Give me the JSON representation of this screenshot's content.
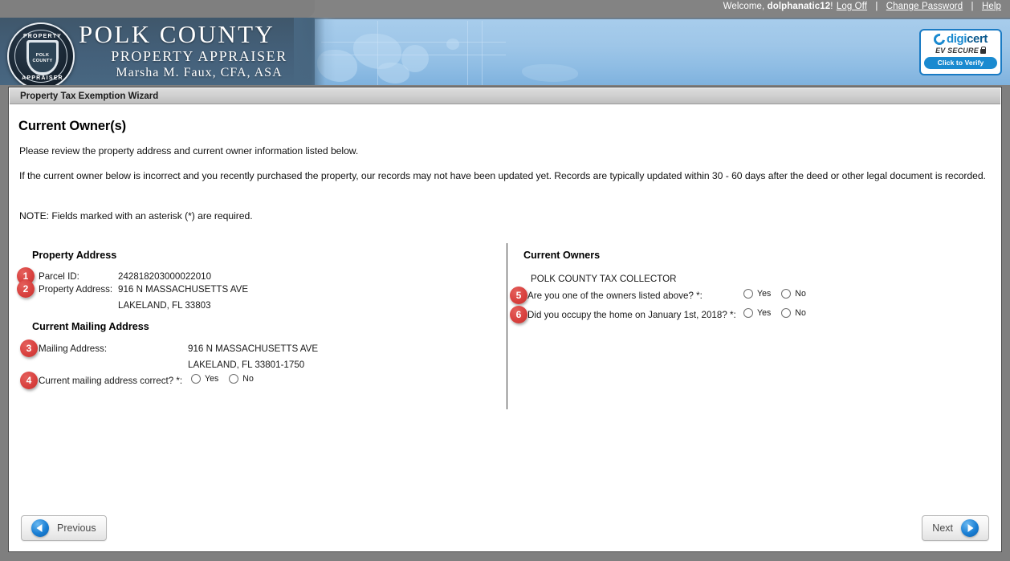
{
  "topbar": {
    "welcome_prefix": "Welcome,",
    "user_name": "dolphanatic12",
    "welcome_suffix": "!",
    "log_off": "Log Off",
    "change_password": "Change Password",
    "help": "Help",
    "separator": "|"
  },
  "banner": {
    "title": "POLK COUNTY",
    "subtitle": "PROPERTY APPRAISER",
    "official_name": "Marsha M. Faux, CFA, ASA",
    "seal": {
      "arc_top": "PROPERTY",
      "arc_bottom": "APPRAISER",
      "shield_line1": "POLK",
      "shield_line2": "COUNTY"
    }
  },
  "digicert": {
    "brand_light": "digi",
    "brand_dark": "cert",
    "tier": "EV SECURE",
    "verify_label": "Click to Verify"
  },
  "panel": {
    "header_title": "Property Tax Exemption Wizard",
    "page_title": "Current Owner(s)",
    "paragraph_1": "Please review the property address and current owner information listed below.",
    "paragraph_2": "If the current owner below is incorrect and you recently purchased the property, our records may not have been updated yet. Records are typically updated within 30 - 60 days after the deed or other legal document is recorded.",
    "paragraph_3": "NOTE: Fields marked with an asterisk (*) are required."
  },
  "property_address": {
    "section_title": "Property Address",
    "parcel_id_label": "Parcel ID:",
    "parcel_id_value": "242818203000022010",
    "property_address_label": "Property Address:",
    "property_address_line1": "916 N MASSACHUSETTS AVE",
    "property_address_line2": "LAKELAND, FL 33803"
  },
  "mailing_address": {
    "section_title": "Current Mailing Address",
    "mailing_address_label": "Mailing Address:",
    "mailing_address_line1": "916 N MASSACHUSETTS AVE",
    "mailing_address_line2": "LAKELAND, FL 33801-1750",
    "correct_question": "Current mailing address correct? *:",
    "yes_label": "Yes",
    "no_label": "No"
  },
  "current_owners": {
    "section_title": "Current Owners",
    "owner_name": "POLK COUNTY TAX COLLECTOR",
    "question_owner": "Are you one of the owners listed above? *:",
    "question_occupy": "Did you occupy the home on January 1st, 2018? *:",
    "yes_label": "Yes",
    "no_label": "No"
  },
  "markers": {
    "m1": "1",
    "m2": "2",
    "m3": "3",
    "m4": "4",
    "m5": "5",
    "m6": "6"
  },
  "footer": {
    "previous_label": "Previous",
    "next_label": "Next"
  },
  "colors": {
    "marker_red": "#d9413f",
    "banner_blue": "#9ec6e8",
    "banner_dark_blue": "#44607a",
    "topbar_gray": "#838383",
    "digicert_blue": "#1a8ad0",
    "arrow_blue": "#1a7fd4"
  }
}
